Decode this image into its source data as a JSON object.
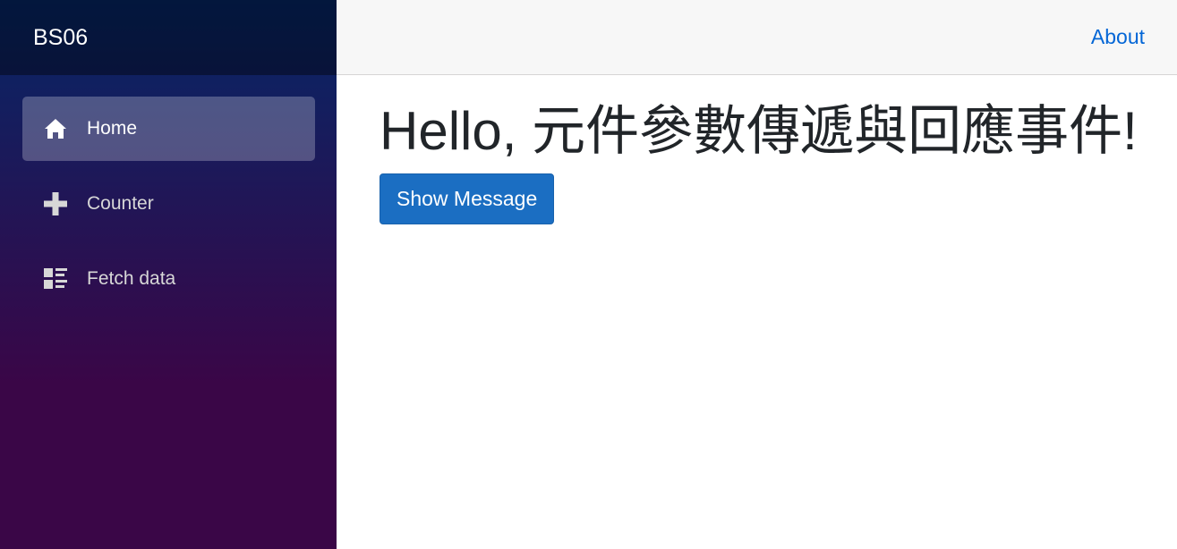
{
  "sidebar": {
    "brand": "BS06",
    "items": [
      {
        "label": "Home",
        "icon": "home-icon",
        "active": true
      },
      {
        "label": "Counter",
        "icon": "plus-icon",
        "active": false
      },
      {
        "label": "Fetch data",
        "icon": "list-rich-icon",
        "active": false
      }
    ],
    "gradient_top": "#052767",
    "gradient_bottom": "#3a0647"
  },
  "header": {
    "about_label": "About",
    "link_color": "#0366d6"
  },
  "main": {
    "heading": "Hello, 元件參數傳遞與回應事件!",
    "button_label": "Show Message",
    "button_color": "#1b6ec2"
  }
}
